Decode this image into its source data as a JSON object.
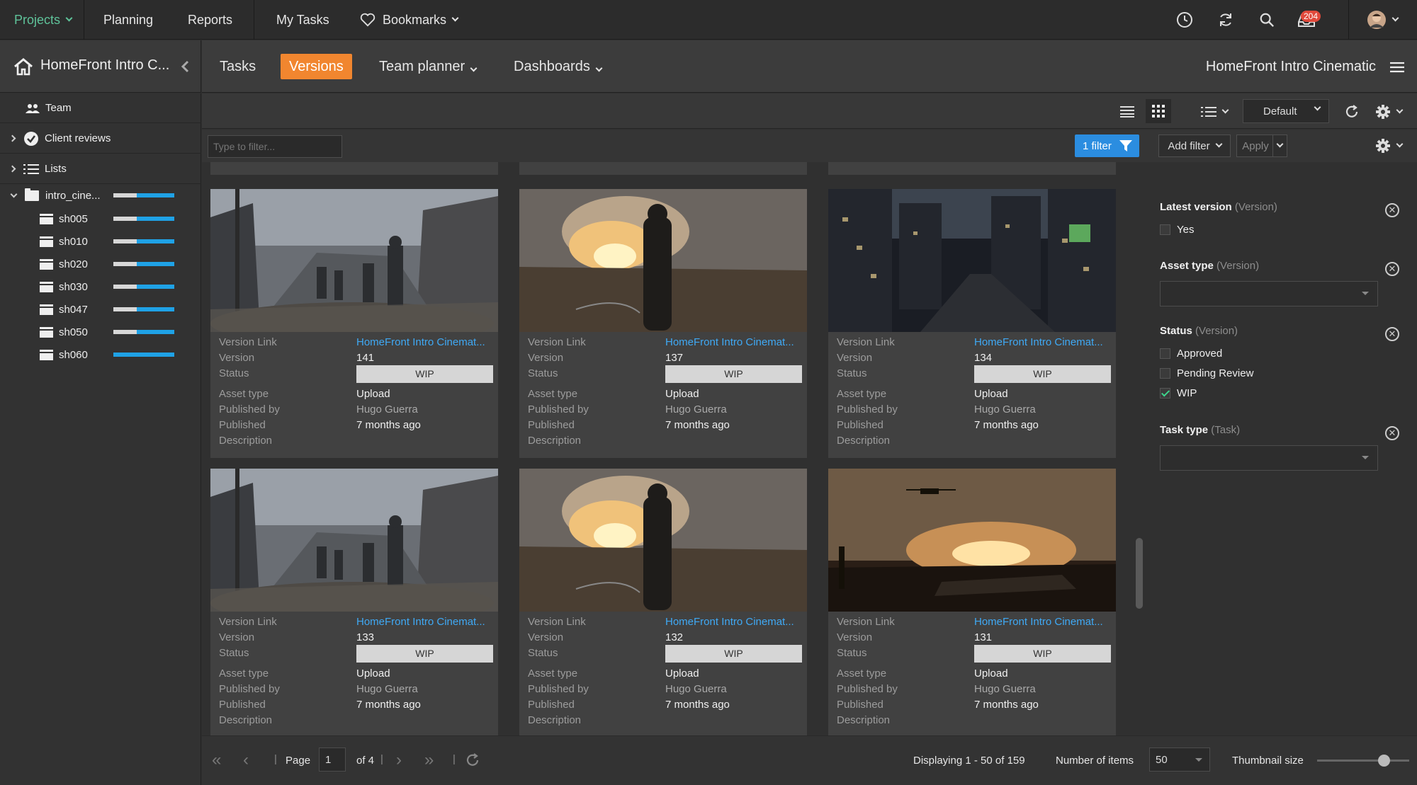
{
  "topnav": {
    "items": [
      {
        "label": "Projects",
        "dropdown": true,
        "active": true
      },
      {
        "label": "Planning"
      },
      {
        "label": "Reports"
      },
      {
        "label": "My Tasks"
      },
      {
        "label": "Bookmarks",
        "dropdown": true
      }
    ],
    "notification_count": "204",
    "icons": [
      "clock-icon",
      "sync-icon",
      "search-icon",
      "inbox-icon",
      "avatar"
    ]
  },
  "project": {
    "short_title": "HomeFront Intro C...",
    "full_title": "HomeFront Intro Cinematic"
  },
  "tabs": [
    {
      "label": "Tasks"
    },
    {
      "label": "Versions",
      "active": true
    },
    {
      "label": "Team planner",
      "dropdown": true
    },
    {
      "label": "Dashboards",
      "dropdown": true
    }
  ],
  "sidebar": {
    "team": "Team",
    "client_reviews": "Client reviews",
    "lists": "Lists",
    "folder": {
      "label": "intro_cine...",
      "progress": 0.38
    },
    "shots": [
      {
        "label": "sh005",
        "progress": 0.38
      },
      {
        "label": "sh010",
        "progress": 0.38
      },
      {
        "label": "sh020",
        "progress": 0.38
      },
      {
        "label": "sh030",
        "progress": 0.38
      },
      {
        "label": "sh047",
        "progress": 0.38
      },
      {
        "label": "sh050",
        "progress": 0.38
      },
      {
        "label": "sh060",
        "progress": 0.0
      }
    ]
  },
  "toolbar": {
    "layout_select": "Default"
  },
  "filterbar": {
    "placeholder": "Type to filter...",
    "filter_button": "1 filter",
    "add_filter": "Add filter",
    "apply": "Apply"
  },
  "labels": {
    "version_link": "Version Link",
    "version": "Version",
    "status": "Status",
    "asset_type": "Asset type",
    "published_by": "Published by",
    "published": "Published",
    "description": "Description"
  },
  "cards": [
    {
      "link": "HomeFront Intro Cinemat...",
      "version": "141",
      "status": "WIP",
      "asset_type": "Upload",
      "published_by": "Hugo Guerra",
      "published": "7 months ago",
      "scene": "street"
    },
    {
      "link": "HomeFront Intro Cinemat...",
      "version": "137",
      "status": "WIP",
      "asset_type": "Upload",
      "published_by": "Hugo Guerra",
      "published": "7 months ago",
      "scene": "blast"
    },
    {
      "link": "HomeFront Intro Cinemat...",
      "version": "134",
      "status": "WIP",
      "asset_type": "Upload",
      "published_by": "Hugo Guerra",
      "published": "7 months ago",
      "scene": "city"
    },
    {
      "link": "HomeFront Intro Cinemat...",
      "version": "133",
      "status": "WIP",
      "asset_type": "Upload",
      "published_by": "Hugo Guerra",
      "published": "7 months ago",
      "scene": "street"
    },
    {
      "link": "HomeFront Intro Cinemat...",
      "version": "132",
      "status": "WIP",
      "asset_type": "Upload",
      "published_by": "Hugo Guerra",
      "published": "7 months ago",
      "scene": "blast"
    },
    {
      "link": "HomeFront Intro Cinemat...",
      "version": "131",
      "status": "WIP",
      "asset_type": "Upload",
      "published_by": "Hugo Guerra",
      "published": "7 months ago",
      "scene": "sunset"
    }
  ],
  "filters": {
    "latest_version": {
      "title": "Latest version",
      "sub": "(Version)",
      "options": [
        {
          "label": "Yes",
          "checked": false
        }
      ]
    },
    "asset_type": {
      "title": "Asset type",
      "sub": "(Version)"
    },
    "status": {
      "title": "Status",
      "sub": "(Version)",
      "options": [
        {
          "label": "Approved",
          "checked": false
        },
        {
          "label": "Pending Review",
          "checked": false
        },
        {
          "label": "WIP",
          "checked": true
        }
      ]
    },
    "task_type": {
      "title": "Task type",
      "sub": "(Task)"
    }
  },
  "footer": {
    "page_label": "Page",
    "page_value": "1",
    "of_pages": "of 4",
    "displaying": "Displaying 1 - 50 of 159",
    "number_of_items_label": "Number of items",
    "number_of_items": "50",
    "thumbnail_size_label": "Thumbnail size",
    "thumbnail_size": 0.72
  },
  "colors": {
    "accent_orange": "#f1862f",
    "link_blue": "#3fa9f5",
    "filter_blue": "#2b8de0",
    "active_green": "#5fc39a",
    "progress_blue": "#1fa2e6"
  }
}
